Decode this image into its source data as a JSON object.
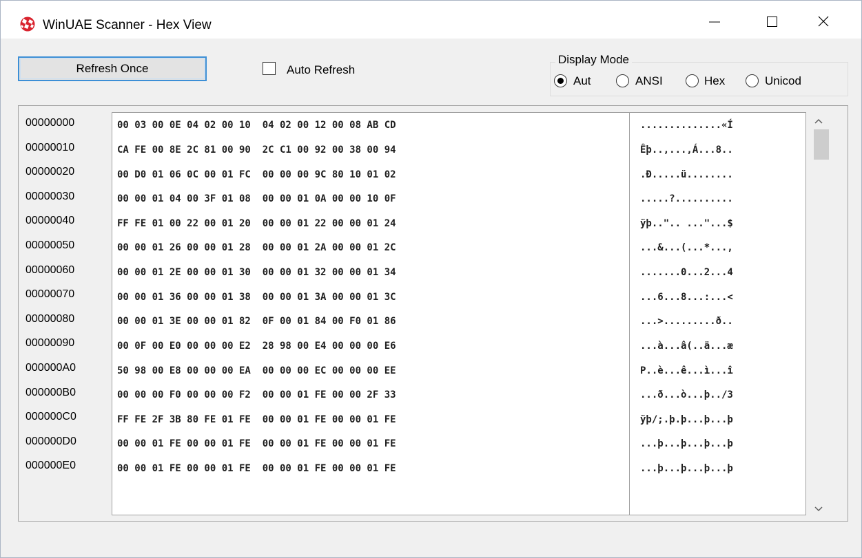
{
  "window": {
    "title": "WinUAE Scanner - Hex View",
    "icon": "amiga-boing-ball-icon"
  },
  "toolbar": {
    "refresh_label": "Refresh Once",
    "auto_refresh_label": "Auto Refresh",
    "auto_refresh_checked": false
  },
  "display_mode": {
    "title": "Display Mode",
    "options": [
      {
        "label": "Aut",
        "selected": true
      },
      {
        "label": "ANSI",
        "selected": false
      },
      {
        "label": "Hex",
        "selected": false
      },
      {
        "label": "Unicod",
        "selected": false
      }
    ]
  },
  "rows": [
    {
      "offset": "00000000",
      "hex": "00 03 00 0E 04 02 00 10  04 02 00 12 00 08 AB CD",
      "ascii": "..............«Í"
    },
    {
      "offset": "00000010",
      "hex": "CA FE 00 8E 2C 81 00 90  2C C1 00 92 00 38 00 94",
      "ascii": "Êþ..,...,Á...8.."
    },
    {
      "offset": "00000020",
      "hex": "00 D0 01 06 0C 00 01 FC  00 00 00 9C 80 10 01 02",
      "ascii": ".Ð.....ü........"
    },
    {
      "offset": "00000030",
      "hex": "00 00 01 04 00 3F 01 08  00 00 01 0A 00 00 10 0F",
      "ascii": ".....?.........."
    },
    {
      "offset": "00000040",
      "hex": "FF FE 01 00 22 00 01 20  00 00 01 22 00 00 01 24",
      "ascii": "ÿþ..\".. ...\"...$"
    },
    {
      "offset": "00000050",
      "hex": "00 00 01 26 00 00 01 28  00 00 01 2A 00 00 01 2C",
      "ascii": "...&...(...*...,"
    },
    {
      "offset": "00000060",
      "hex": "00 00 01 2E 00 00 01 30  00 00 01 32 00 00 01 34",
      "ascii": ".......0...2...4"
    },
    {
      "offset": "00000070",
      "hex": "00 00 01 36 00 00 01 38  00 00 01 3A 00 00 01 3C",
      "ascii": "...6...8...:...<"
    },
    {
      "offset": "00000080",
      "hex": "00 00 01 3E 00 00 01 82  0F 00 01 84 00 F0 01 86",
      "ascii": "...>.........ð.."
    },
    {
      "offset": "00000090",
      "hex": "00 0F 00 E0 00 00 00 E2  28 98 00 E4 00 00 00 E6",
      "ascii": "...à...â(..ä...æ"
    },
    {
      "offset": "000000A0",
      "hex": "50 98 00 E8 00 00 00 EA  00 00 00 EC 00 00 00 EE",
      "ascii": "P..è...ê...ì...î"
    },
    {
      "offset": "000000B0",
      "hex": "00 00 00 F0 00 00 00 F2  00 00 01 FE 00 00 2F 33",
      "ascii": "...ð...ò...þ../3"
    },
    {
      "offset": "000000C0",
      "hex": "FF FE 2F 3B 80 FE 01 FE  00 00 01 FE 00 00 01 FE",
      "ascii": "ÿþ/;.þ.þ...þ...þ"
    },
    {
      "offset": "000000D0",
      "hex": "00 00 01 FE 00 00 01 FE  00 00 01 FE 00 00 01 FE",
      "ascii": "...þ...þ...þ...þ"
    },
    {
      "offset": "000000E0",
      "hex": "00 00 01 FE 00 00 01 FE  00 00 01 FE 00 00 01 FE",
      "ascii": "...þ...þ...þ...þ"
    }
  ]
}
